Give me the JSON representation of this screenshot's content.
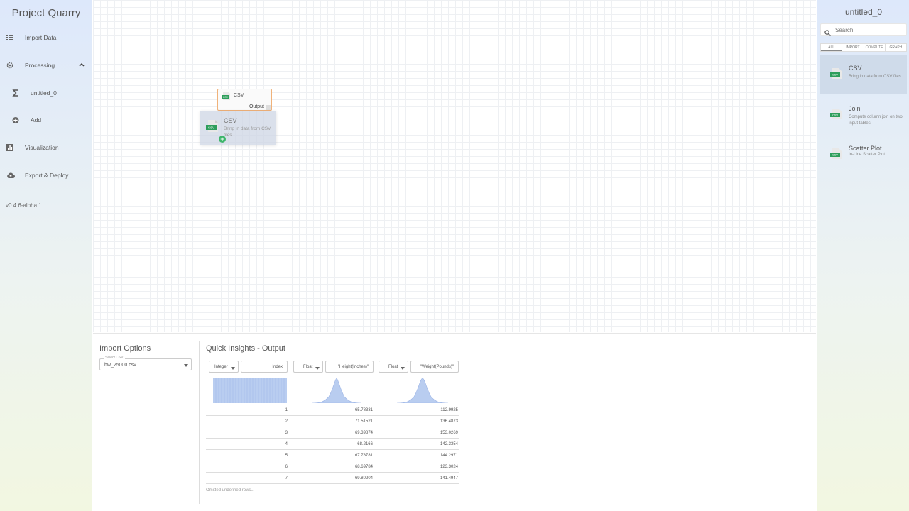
{
  "sidebar": {
    "app_title": "Project Quarry",
    "items": [
      {
        "label": "Import Data",
        "icon": "list-icon"
      },
      {
        "label": "Processing",
        "icon": "gear-icon"
      },
      {
        "label": "untitled_0",
        "icon": "sigma-icon"
      },
      {
        "label": "Add",
        "icon": "add-circle-icon"
      },
      {
        "label": "Visualization",
        "icon": "bar-chart-icon"
      },
      {
        "label": "Export & Deploy",
        "icon": "cloud-upload-icon"
      }
    ],
    "version": "v0.4.6-alpha.1"
  },
  "canvas": {
    "node": {
      "title": "CSV",
      "output_port": "Output"
    },
    "drag_ghost": {
      "title": "CSV",
      "description": "Bring in data from CSV files"
    }
  },
  "palette": {
    "title": "untitled_0",
    "search_placeholder": "Search",
    "filters": [
      "ALL",
      "IMPORT",
      "COMPUTE",
      "GRAPH"
    ],
    "active_filter": "ALL",
    "items": [
      {
        "title": "CSV",
        "description": "Bring in data from CSV files",
        "icon_label": "CSV"
      },
      {
        "title": "Join",
        "description": "Compute column join on two input tables",
        "icon_label": "CSV"
      },
      {
        "title": "Scatter Plot",
        "description": "In-Line Scatter Plot",
        "icon_label": "CSV"
      }
    ]
  },
  "import_options": {
    "title": "Import Options",
    "select_label": "Select CSV",
    "select_value": "hw_25000.csv"
  },
  "quick_insights": {
    "title": "Quick Insights - Output",
    "columns": [
      {
        "type": "Integer",
        "name": "Index"
      },
      {
        "type": "Float",
        "name": "\"Height(Inches)\""
      },
      {
        "type": "Float",
        "name": "\"Weight(Pounds)\""
      }
    ],
    "rows": [
      [
        "1",
        "65.78331",
        "112.9925"
      ],
      [
        "2",
        "71.51521",
        "136.4873"
      ],
      [
        "3",
        "69.39874",
        "153.0269"
      ],
      [
        "4",
        "68.2166",
        "142.3354"
      ],
      [
        "5",
        "67.78781",
        "144.2971"
      ],
      [
        "6",
        "68.69784",
        "123.3024"
      ],
      [
        "7",
        "69.80204",
        "141.4947"
      ]
    ],
    "footer": "Omitted undefined rows..."
  },
  "colors": {
    "accent_orange": "#f0b27a",
    "node_green": "#2e9e5b",
    "hist_blue": "#b9cdf0"
  }
}
